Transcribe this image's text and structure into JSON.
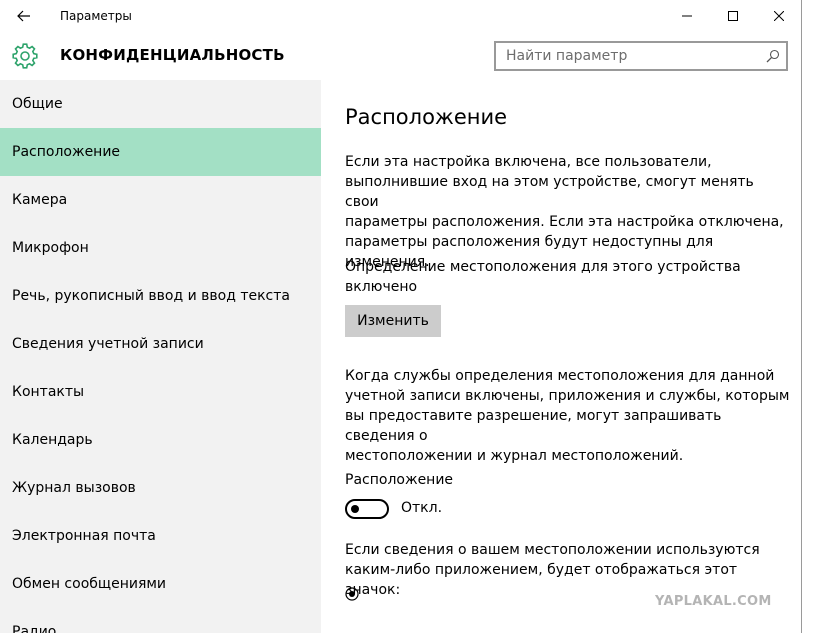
{
  "titlebar": {
    "app_title": "Параметры"
  },
  "header": {
    "section_title": "КОНФИДЕНЦИАЛЬНОСТЬ",
    "search_placeholder": "Найти параметр"
  },
  "sidebar": {
    "items": [
      {
        "label": "Общие",
        "active": false
      },
      {
        "label": "Расположение",
        "active": true
      },
      {
        "label": "Камера",
        "active": false
      },
      {
        "label": "Микрофон",
        "active": false
      },
      {
        "label": "Речь, рукописный ввод и ввод текста",
        "active": false
      },
      {
        "label": "Сведения учетной записи",
        "active": false
      },
      {
        "label": "Контакты",
        "active": false
      },
      {
        "label": "Календарь",
        "active": false
      },
      {
        "label": "Журнал вызовов",
        "active": false
      },
      {
        "label": "Электронная почта",
        "active": false
      },
      {
        "label": "Обмен сообщениями",
        "active": false
      },
      {
        "label": "Радио",
        "active": false
      }
    ]
  },
  "main": {
    "title": "Расположение",
    "intro_lines": [
      "Если эта настройка включена, все пользователи,",
      "выполнившие вход на этом устройстве, смогут менять свои",
      "параметры расположения. Если эта настройка отключена,",
      "параметры расположения будут недоступны для изменения."
    ],
    "device_status_lines": [
      "Определение местоположения для этого устройства",
      "включено"
    ],
    "change_button": "Изменить",
    "services_lines": [
      "Когда службы определения местоположения для данной",
      "учетной записи включены, приложения и службы, которым",
      "вы предоставите разрешение, могут запрашивать сведения о",
      "местоположении и журнал местоположений."
    ],
    "location_toggle": {
      "label": "Расположение",
      "state_text": "Откл.",
      "on": false
    },
    "icon_note_lines": [
      "Если сведения о вашем местоположении используются",
      "каким-либо приложением, будет отображаться этот значок:"
    ]
  },
  "colors": {
    "accent": "#a3e0c5",
    "sidebar_bg": "#f2f2f2",
    "button_bg": "#cccccc",
    "gear": "#2ea36b"
  },
  "watermark": "YAPLAKAL.COM"
}
